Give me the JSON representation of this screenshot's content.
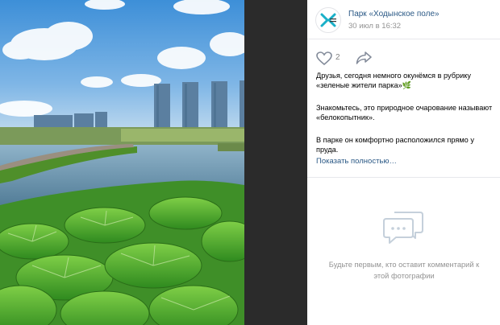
{
  "post": {
    "group_name": "Парк «Ходынское поле»",
    "date": "30 июл в 16:32",
    "likes": "2",
    "text_paragraph_1": "Друзья, сегодня немного окунёмся в рубрику «зеленые жители парка»🌿",
    "text_paragraph_2": "Знакомьтесь, это природное очарование называют «белокопытник».",
    "text_paragraph_3": "В парке он комфортно расположился прямо у пруда.",
    "show_more": "Показать полностью…"
  },
  "comments": {
    "empty_text": "Будьте первым, кто оставит комментарий к этой фотографии"
  },
  "icons": {
    "logo": "park-logo-icon",
    "like": "heart-icon",
    "share": "share-arrow-icon",
    "empty_comments": "speech-bubbles-icon"
  },
  "colors": {
    "link": "#2a5885",
    "muted": "#939393",
    "logo_accent": "#1ab0c8"
  }
}
